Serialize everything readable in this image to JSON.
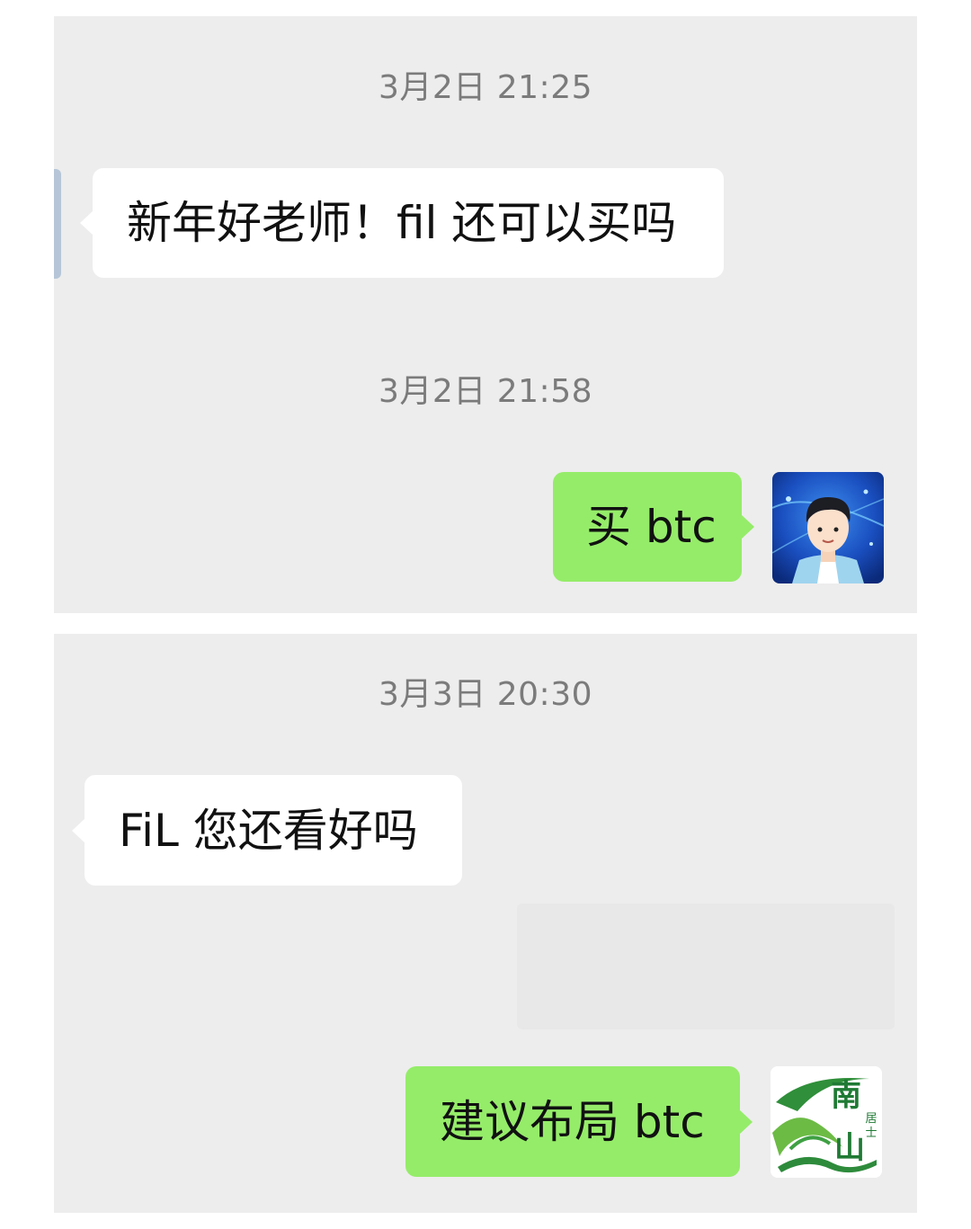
{
  "conversation": {
    "section1": {
      "time1": "3月2日 21:25",
      "msg1": "新年好老师！fil 还可以买吗",
      "time2": "3月2日 21:58",
      "reply1": "买 btc"
    },
    "section2": {
      "time": "3月3日 20:30",
      "msg": "FiL 您还看好吗",
      "reply": "建议布局 btc",
      "avatar_logo_text": "南山居士"
    }
  },
  "colors": {
    "background": "#ededed",
    "incoming_bubble": "#ffffff",
    "outgoing_bubble": "#95ec69",
    "timestamp": "#7b7b7b"
  },
  "icons": {
    "avatar1": "cartoon-man-avatar-icon",
    "avatar2": "nanshan-logo-icon"
  }
}
